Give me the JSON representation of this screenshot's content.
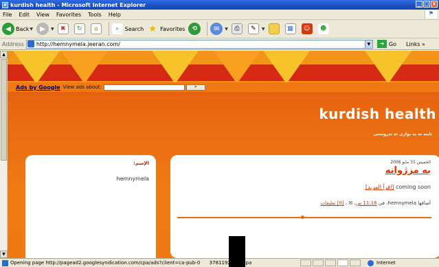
{
  "window": {
    "title": "kurdish health - Microsoft Internet Explorer",
    "minimize": "_",
    "restore": "□",
    "close": "X"
  },
  "menu": [
    "File",
    "Edit",
    "View",
    "Favorites",
    "Tools",
    "Help"
  ],
  "toolbar": {
    "back": "Back",
    "search": "Search",
    "favorites": "Favorites"
  },
  "address": {
    "label": "Address",
    "url": "http://hemnymela.jeeran.com/",
    "go": "Go",
    "links": "Links"
  },
  "ads": {
    "link": "Ads by Google",
    "label": "View ads about:",
    "button": "»"
  },
  "site": {
    "title": "kurdish health",
    "description": "تايبه ته به بواری ته ندروستی"
  },
  "sidebar": {
    "label": "الإسم:",
    "name": "hemnymela"
  },
  "post": {
    "date": "الخميس 31 مايو 2006",
    "title": "به مزژوانه",
    "body": "coming soon",
    "read_more": "[اقرأ المزيد]",
    "author_prefix": "أضافها",
    "author": "hemnymela",
    "time_prefix": "، في",
    "time": "11:16 ص",
    "comments": "[0] تعليقات"
  },
  "status": {
    "text": "Opening page http://pagead2.googlesyndication.com/cpa/ads?client=ca-pub-0",
    "text_tail": "37811921958cpa",
    "zone": "Internet"
  }
}
